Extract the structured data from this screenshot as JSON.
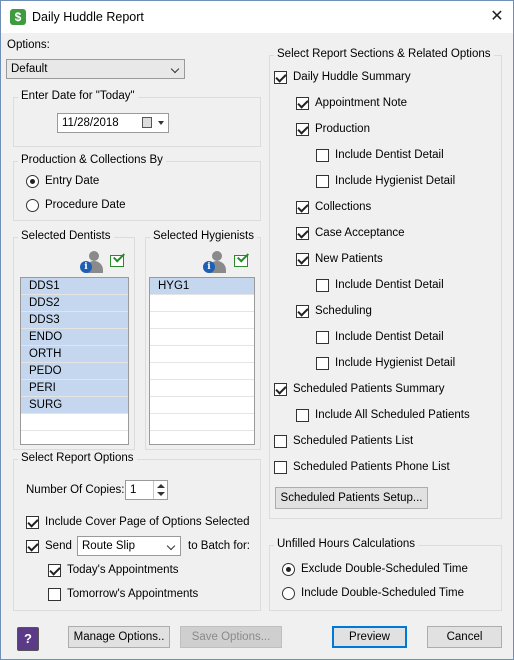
{
  "window": {
    "title": "Daily Huddle Report",
    "close_glyph": "✕",
    "app_icon_glyph": "$"
  },
  "options": {
    "label": "Options:",
    "value": "Default"
  },
  "date_group": {
    "title": "Enter Date for \"Today\"",
    "value": "11/28/2018"
  },
  "prod_group": {
    "title": "Production & Collections By",
    "options": [
      {
        "label": "Entry Date",
        "selected": true
      },
      {
        "label": "Procedure Date",
        "selected": false
      }
    ]
  },
  "dentists": {
    "title": "Selected Dentists",
    "items": [
      "DDS1",
      "DDS2",
      "DDS3",
      "ENDO",
      "ORTH",
      "PEDO",
      "PERI",
      "SURG"
    ]
  },
  "hygienists": {
    "title": "Selected Hygienists",
    "items": [
      "HYG1"
    ]
  },
  "report_options": {
    "title": "Select Report Options",
    "copies_label": "Number Of Copies:",
    "copies_value": "1",
    "cover_page_label": "Include Cover Page of Options Selected",
    "send_label": "Send",
    "send_value": "Route Slip",
    "batch_label": "to Batch for:",
    "todays_label": "Today's Appointments",
    "tomorrows_label": "Tomorrow's Appointments"
  },
  "sections": {
    "title": "Select Report Sections & Related Options",
    "items": [
      {
        "label": "Daily Huddle Summary",
        "checked": true
      },
      {
        "label": "Appointment Note",
        "checked": true
      },
      {
        "label": "Production",
        "checked": true
      },
      {
        "label": "Include Dentist Detail",
        "checked": false
      },
      {
        "label": "Include Hygienist Detail",
        "checked": false
      },
      {
        "label": "Collections",
        "checked": true
      },
      {
        "label": "Case Acceptance",
        "checked": true
      },
      {
        "label": "New Patients",
        "checked": true
      },
      {
        "label": "Include Dentist Detail",
        "checked": false
      },
      {
        "label": "Scheduling",
        "checked": true
      },
      {
        "label": "Include Dentist Detail",
        "checked": false
      },
      {
        "label": "Include Hygienist Detail",
        "checked": false
      },
      {
        "label": "Scheduled Patients Summary",
        "checked": true
      },
      {
        "label": "Include All Scheduled Patients",
        "checked": false
      },
      {
        "label": "Scheduled Patients List",
        "checked": false
      },
      {
        "label": "Scheduled Patients Phone List",
        "checked": false
      }
    ],
    "setup_button": "Scheduled Patients Setup..."
  },
  "unfilled": {
    "title": "Unfilled Hours Calculations",
    "options": [
      {
        "label": "Exclude Double-Scheduled Time",
        "selected": true
      },
      {
        "label": "Include Double-Scheduled Time",
        "selected": false
      }
    ]
  },
  "buttons": {
    "manage": "Manage Options..",
    "save": "Save Options...",
    "preview": "Preview",
    "cancel": "Cancel",
    "help_glyph": "?"
  }
}
